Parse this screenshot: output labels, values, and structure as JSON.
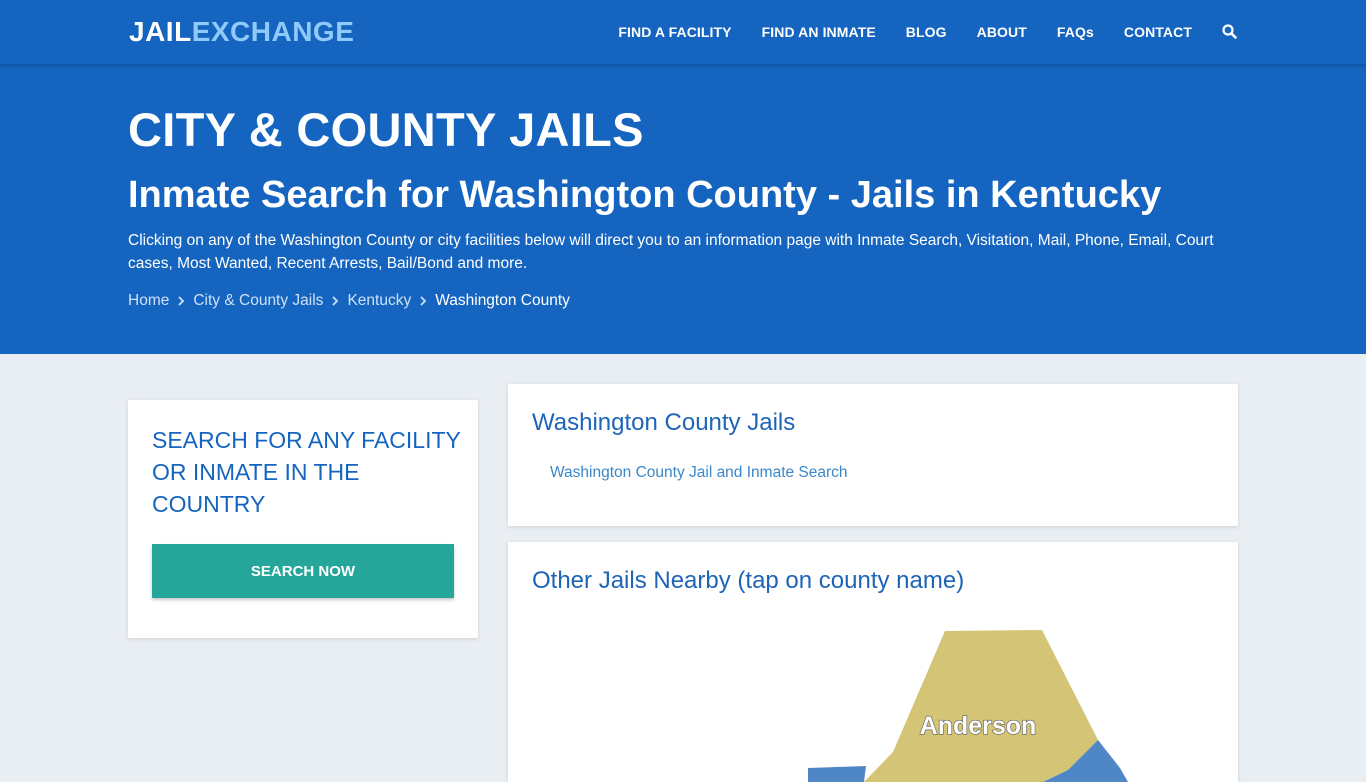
{
  "brand": {
    "part1": "JAIL",
    "part2": "EXCHANGE"
  },
  "nav": {
    "items": [
      "FIND A FACILITY",
      "FIND AN INMATE",
      "BLOG",
      "ABOUT",
      "FAQs",
      "CONTACT"
    ],
    "search_icon": "search-icon"
  },
  "hero": {
    "title": "CITY & COUNTY JAILS",
    "subtitle": "Inmate Search for Washington County - Jails in Kentucky",
    "description": "Clicking on any of the Washington County or city facilities below will direct you to an information page with Inmate Search, Visitation, Mail, Phone, Email, Court cases, Most Wanted, Recent Arrests, Bail/Bond and more.",
    "breadcrumb": [
      "Home",
      "City & County Jails",
      "Kentucky",
      "Washington County"
    ]
  },
  "sidebar_card": {
    "heading": "SEARCH FOR ANY FACILITY OR INMATE IN THE COUNTRY",
    "button_label": "SEARCH NOW"
  },
  "jails_card": {
    "heading": "Washington County Jails",
    "link": "Washington County Jail and Inmate Search"
  },
  "nearby_card": {
    "heading": "Other Jails Nearby (tap on county name)",
    "counties": [
      {
        "name": "Anderson",
        "color": "#d4c475"
      },
      {
        "name": "",
        "color": "#4f86c6"
      }
    ]
  },
  "colors": {
    "primary": "#1565c0",
    "accent_teal": "#26a69a",
    "logo_light": "#90caf9",
    "page_bg": "#e9eef2"
  }
}
